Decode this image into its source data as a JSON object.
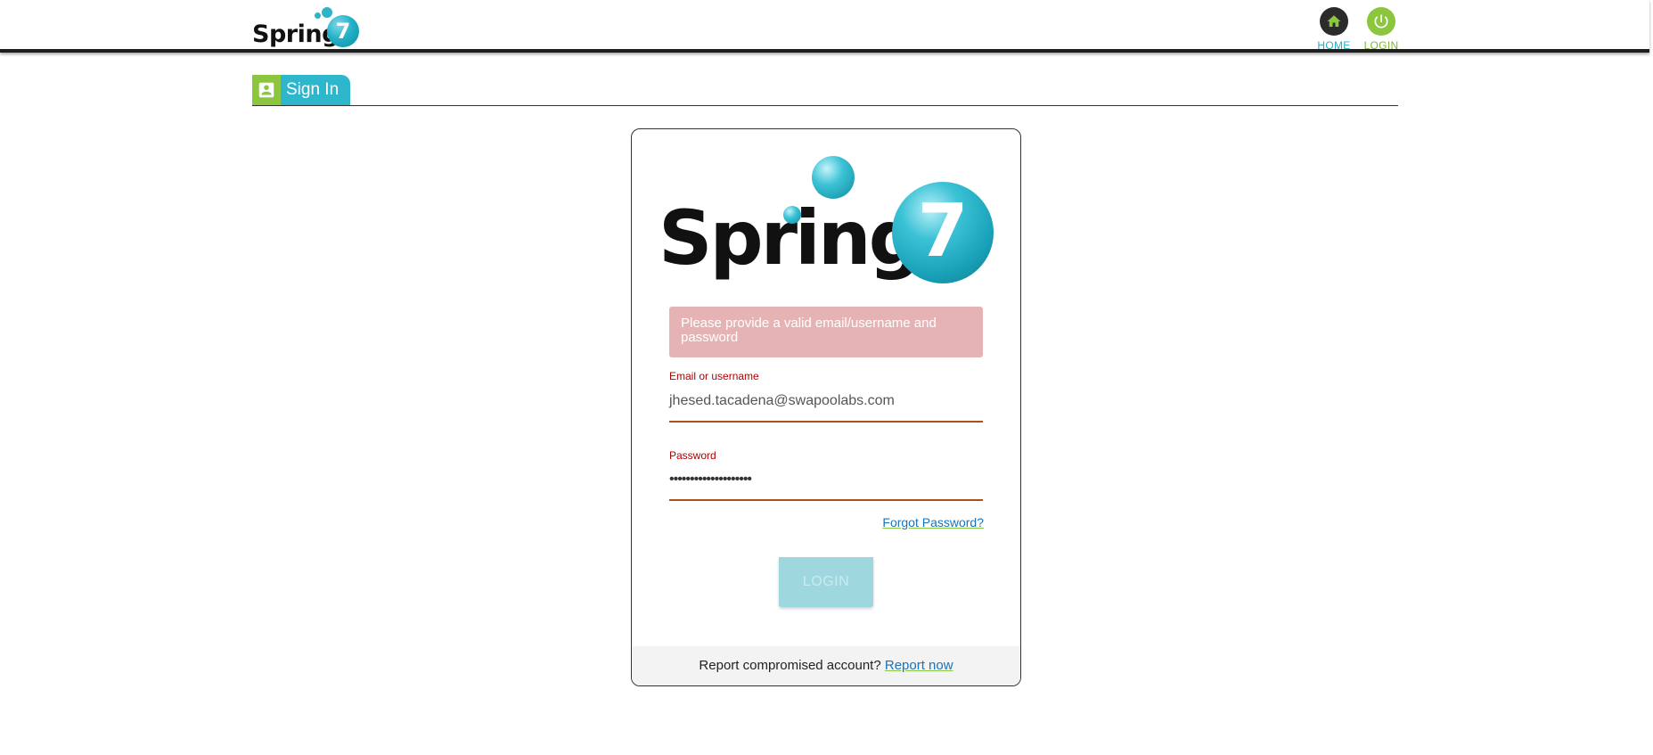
{
  "header": {
    "logo_word": "Spring",
    "logo_number": "7",
    "nav": [
      {
        "label": "HOME",
        "icon": "home-icon",
        "color": "#29aec4"
      },
      {
        "label": "LOGIN",
        "icon": "power-icon",
        "color": "#8cc63f"
      }
    ]
  },
  "tabs": [
    {
      "label": "Sign In",
      "icon": "account-box-icon",
      "active": true
    }
  ],
  "card": {
    "logo_word": "Spring",
    "logo_number": "7",
    "alert": "Please provide a valid email/username and password",
    "email": {
      "label": "Email or username",
      "value": "jhesed.tacadena@swapoolabs.com"
    },
    "password": {
      "label": "Password",
      "value": "••••••••••••••••••••"
    },
    "forgot_password": "Forgot Password?",
    "login_button": "LOGIN",
    "footer": {
      "text": "Report compromised account?",
      "link": "Report now"
    }
  },
  "colors": {
    "brand_teal": "#2eb6cc",
    "brand_green": "#8cc63f",
    "error": "#b00000",
    "alert_bg": "#e6b3b5"
  }
}
